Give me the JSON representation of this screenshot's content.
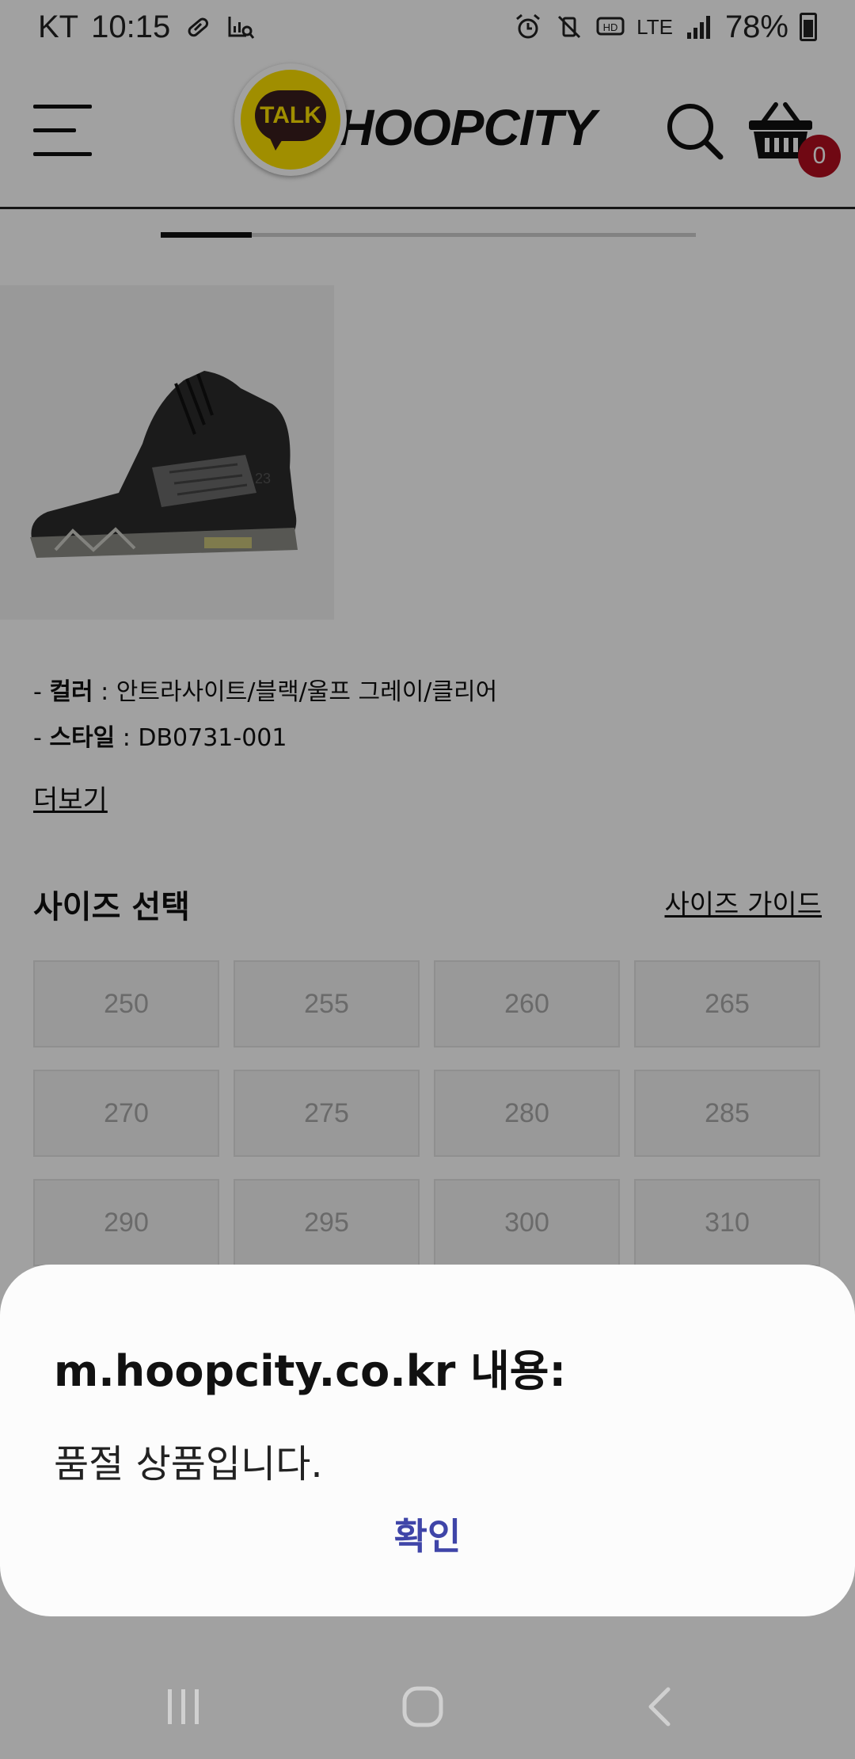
{
  "status_bar": {
    "carrier": "KT",
    "time": "10:15",
    "network": "LTE",
    "battery": "78%"
  },
  "header": {
    "brand": "HOOPCITY",
    "talk_label": "TALK",
    "cart_count": "0"
  },
  "carousel": {
    "progress_fraction": 0.17
  },
  "product": {
    "color_label": "컬러",
    "color_value": " : 안트라사이트/블랙/울프 그레이/클리어",
    "style_label": "스타일",
    "style_value": " : DB0731-001",
    "more_link": "더보기"
  },
  "size_section": {
    "title": "사이즈 선택",
    "guide_link": "사이즈 가이드",
    "sizes": [
      "250",
      "255",
      "260",
      "265",
      "270",
      "275",
      "280",
      "285",
      "290",
      "295",
      "300",
      "310"
    ]
  },
  "dialog": {
    "title": "m.hoopcity.co.kr 내용:",
    "message": "품절 상품입니다.",
    "confirm": "확인"
  },
  "colors": {
    "accent_link": "#3f45a8",
    "badge": "#b20d1f",
    "kakao_yellow": "#fde100"
  }
}
